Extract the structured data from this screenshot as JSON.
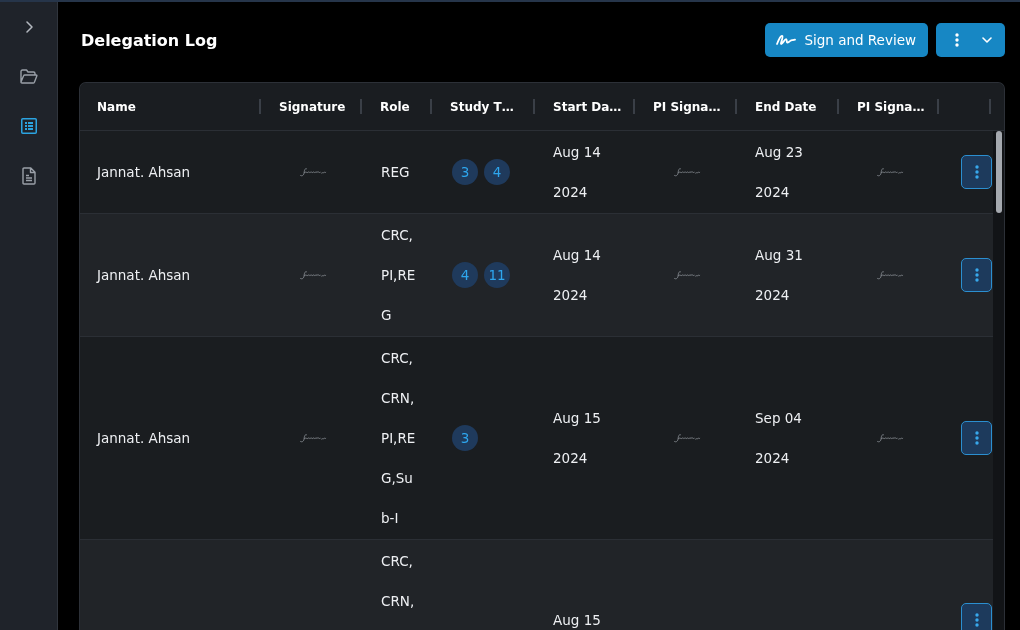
{
  "sidebar": {
    "items": [
      {
        "kind": "folder",
        "selected": false
      },
      {
        "kind": "list",
        "selected": true
      },
      {
        "kind": "document",
        "selected": false
      }
    ]
  },
  "header": {
    "title": "Delegation Log",
    "actions": [
      {
        "kind": "sign",
        "label": "Sign and Review"
      },
      {
        "kind": "more"
      }
    ]
  },
  "table": {
    "columns": [
      "Name",
      "Signature",
      "Role",
      "Study T…",
      "Start Da…",
      "PI Signa…",
      "End Date",
      "PI Signa…"
    ],
    "rows": [
      {
        "name": "Jannat. Ahsan",
        "signature_signed": true,
        "role": "REG",
        "study_types": [
          "3",
          "4"
        ],
        "start_date": "Aug 14 2024",
        "pi_signature_1_signed": true,
        "end_date": "Aug 23 2024",
        "pi_signature_2_signed": true
      },
      {
        "name": "Jannat. Ahsan",
        "signature_signed": true,
        "role": "CRC,PI,REG",
        "study_types": [
          "4",
          "11"
        ],
        "start_date": "Aug 14 2024",
        "pi_signature_1_signed": true,
        "end_date": "Aug 31 2024",
        "pi_signature_2_signed": true
      },
      {
        "name": "Jannat. Ahsan",
        "signature_signed": true,
        "role": "CRC,CRN,PI,REG,Sub-I",
        "study_types": [
          "3"
        ],
        "start_date": "Aug 15 2024",
        "pi_signature_1_signed": true,
        "end_date": "Sep 04 2024",
        "pi_signature_2_signed": true
      },
      {
        "role": "CRC,CRN,",
        "start_date": "Aug 15"
      }
    ]
  }
}
